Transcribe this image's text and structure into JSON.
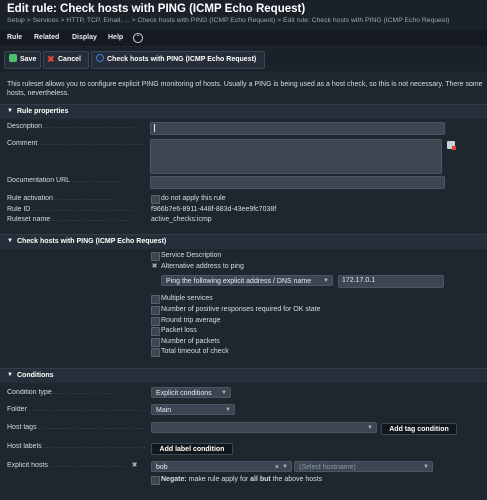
{
  "header": {
    "title": "Edit rule: Check hosts with PING (ICMP Echo Request)",
    "breadcrumb": "Setup > Services > HTTP, TCP, Email, ... > Check hosts with PING (ICMP Echo Request) > Edit rule: Check hosts with PING (ICMP Echo Request)"
  },
  "menu": {
    "items": [
      "Rule",
      "Related",
      "Display",
      "Help"
    ],
    "toggle_icon": "chevron-up-icon"
  },
  "toolbar": {
    "save_label": "Save",
    "cancel_label": "Cancel",
    "ruleset_label": "Check hosts with PING (ICMP Echo Request)"
  },
  "intro": "This ruleset allows you to configure explicit PING monitoring of hosts. Usually a PING is being used as a host check, so this is not necessary. There some hosts, nevertheless.",
  "rule_properties": {
    "heading": "Rule properties",
    "description_label": "Description",
    "comment_label": "Comment",
    "doc_url_label": "Documentation URL",
    "activation_label": "Rule activation",
    "activation_option": "do not apply this rule",
    "rule_id_label": "Rule ID",
    "rule_id": "f966b7e6-8911-448f-883d-43ee9fc7038f",
    "ruleset_name_label": "Ruleset name",
    "ruleset_name": "active_checks:icmp"
  },
  "ping": {
    "heading": "Check hosts with PING (ICMP Echo Request)",
    "options": [
      "Service Description",
      "Alternative address to ping",
      "Multiple services",
      "Number of positive responses required for OK state",
      "Round trip average",
      "Packet loss",
      "Number of packets",
      "Total timeout of check"
    ],
    "address_mode": "Ping the following explicit address / DNS name",
    "address_value": "172.17.0.1"
  },
  "conditions": {
    "heading": "Conditions",
    "condition_type_label": "Condition type",
    "condition_type_value": "Explicit conditions",
    "folder_label": "Folder",
    "folder_value": "Main",
    "host_tags_label": "Host tags",
    "add_tag_label": "Add tag condition",
    "host_labels_label": "Host labels",
    "add_label_label": "Add label condition",
    "explicit_hosts_label": "Explicit hosts",
    "host_value": "bob",
    "host_placeholder": "(Select hostname)",
    "negate_bold": "Negate:",
    "negate_text_1": "make rule apply for",
    "negate_text_bold": "all but",
    "negate_text_2": "the above hosts"
  },
  "colors": {
    "save_icon": "#4bc26b",
    "cancel_icon": "#e0453a",
    "info_icon": "#3d7bd6",
    "page_bg": "#1e262e"
  }
}
